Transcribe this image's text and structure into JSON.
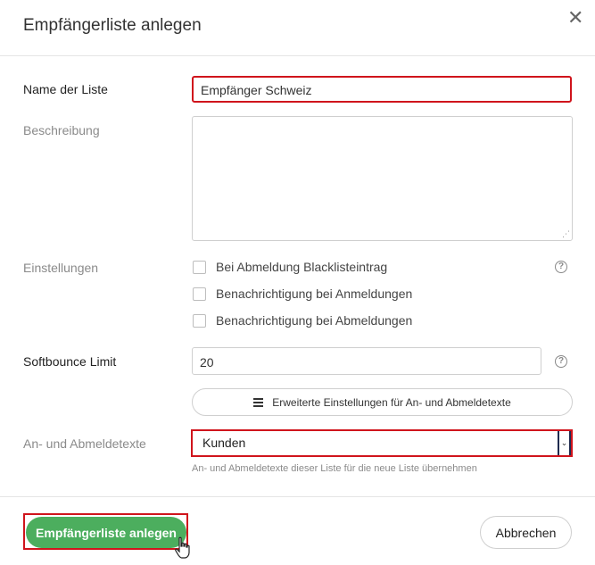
{
  "dialog": {
    "title": "Empfängerliste anlegen",
    "close_glyph": "✕"
  },
  "form": {
    "name": {
      "label": "Name der Liste",
      "value": "Empfänger Schweiz"
    },
    "description": {
      "label": "Beschreibung",
      "value": ""
    },
    "settings": {
      "label": "Einstellungen",
      "options": [
        {
          "label": "Bei Abmeldung Blacklisteintrag",
          "checked": false
        },
        {
          "label": "Benachrichtigung bei Anmeldungen",
          "checked": false
        },
        {
          "label": "Benachrichtigung bei Abmeldungen",
          "checked": false
        }
      ],
      "help_glyph": "?"
    },
    "softbounce": {
      "label": "Softbounce Limit",
      "value": "20",
      "help_glyph": "?"
    },
    "advanced_button": {
      "label": "Erweiterte Einstellungen für An- und Abmeldetexte",
      "icon": "menu-icon"
    },
    "texts": {
      "label": "An- und Abmeldetexte",
      "selected": "Kunden",
      "hint": "An- und Abmeldetexte dieser Liste für die neue Liste übernehmen"
    }
  },
  "footer": {
    "primary_label": "Empfängerliste anlegen",
    "secondary_label": "Abbrechen"
  },
  "colors": {
    "primary": "#4cae5e",
    "highlight": "#d0141c"
  }
}
